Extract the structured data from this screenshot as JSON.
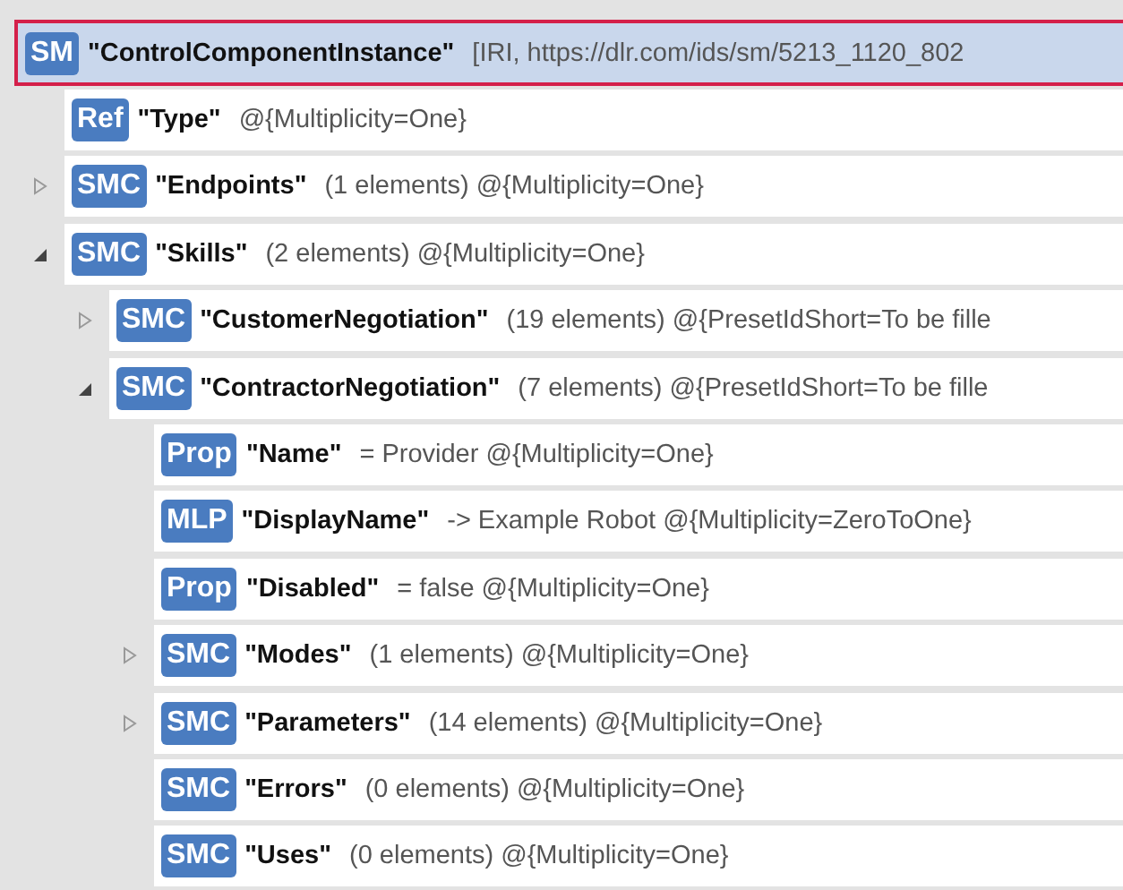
{
  "tree": {
    "badge": "SM",
    "name": "\"ControlComponentInstance\"",
    "detail": "[IRI, https://dlr.com/ids/sm/5213_1120_802",
    "selected": true,
    "children": [
      {
        "badge": "Ref",
        "name": "\"Type\"",
        "detail": "@{Multiplicity=One}",
        "selected": false
      },
      {
        "badge": "SMC",
        "name": "\"Endpoints\"",
        "detail": "(1 elements) @{Multiplicity=One}",
        "selected": false,
        "expanded": false
      },
      {
        "badge": "SMC",
        "name": "\"Skills\"",
        "detail": "(2 elements) @{Multiplicity=One}",
        "selected": false,
        "expanded": true,
        "children": [
          {
            "badge": "SMC",
            "name": "\"CustomerNegotiation\"",
            "detail": "(19 elements) @{PresetIdShort=To be fille",
            "selected": false,
            "expanded": false
          },
          {
            "badge": "SMC",
            "name": "\"ContractorNegotiation\"",
            "detail": "(7 elements) @{PresetIdShort=To be fille",
            "selected": false,
            "expanded": true,
            "children": [
              {
                "badge": "Prop",
                "name": "\"Name\"",
                "detail": "= Provider @{Multiplicity=One}",
                "selected": false
              },
              {
                "badge": "MLP",
                "name": "\"DisplayName\"",
                "detail": "-> Example Robot @{Multiplicity=ZeroToOne}",
                "selected": false
              },
              {
                "badge": "Prop",
                "name": "\"Disabled\"",
                "detail": "= false @{Multiplicity=One}",
                "selected": false
              },
              {
                "badge": "SMC",
                "name": "\"Modes\"",
                "detail": "(1 elements) @{Multiplicity=One}",
                "selected": false,
                "expanded": false
              },
              {
                "badge": "SMC",
                "name": "\"Parameters\"",
                "detail": "(14 elements) @{Multiplicity=One}",
                "selected": false,
                "expanded": false
              },
              {
                "badge": "SMC",
                "name": "\"Errors\"",
                "detail": "(0 elements) @{Multiplicity=One}",
                "selected": false
              },
              {
                "badge": "SMC",
                "name": "\"Uses\"",
                "detail": "(0 elements) @{Multiplicity=One}",
                "selected": false
              }
            ]
          }
        ]
      }
    ]
  }
}
